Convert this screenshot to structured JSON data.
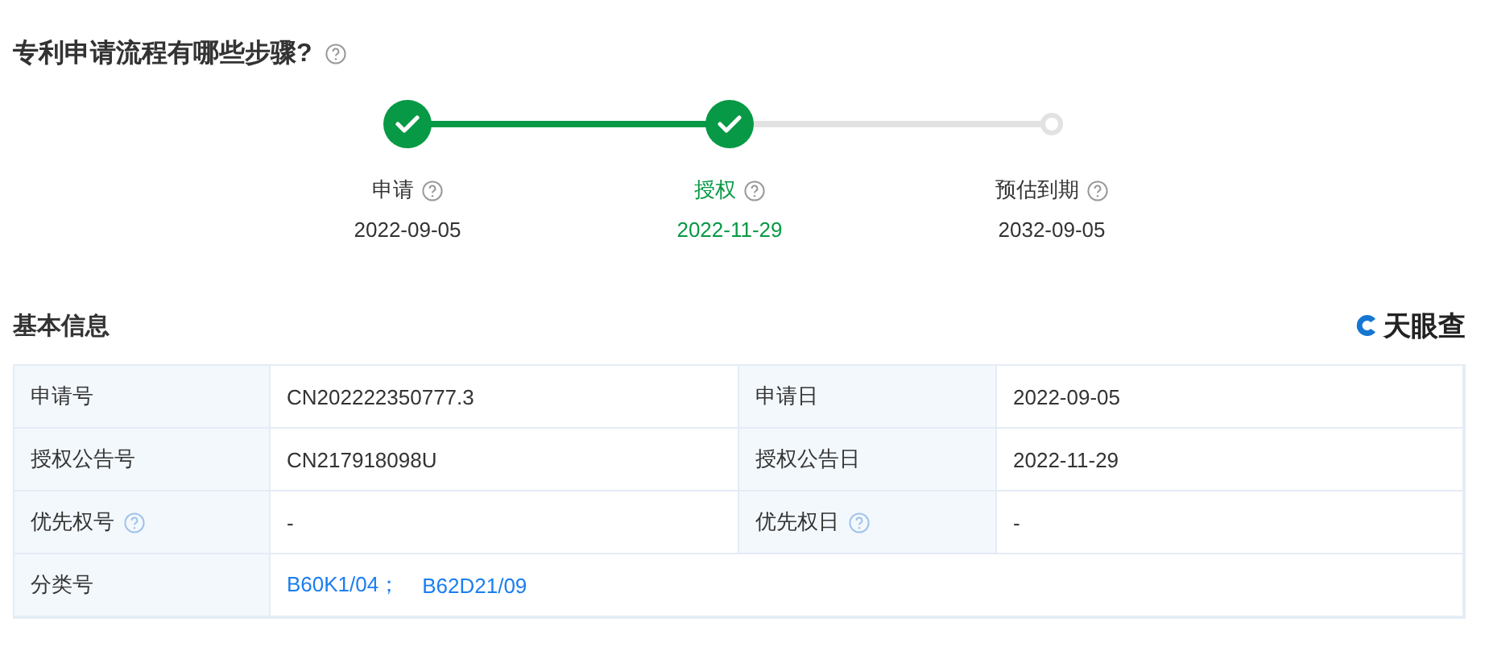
{
  "question": {
    "title": "专利申请流程有哪些步骤?"
  },
  "steps": [
    {
      "label": "申请",
      "date": "2022-09-05",
      "done": true,
      "current": false
    },
    {
      "label": "授权",
      "date": "2022-11-29",
      "done": true,
      "current": true
    },
    {
      "label": "预估到期",
      "date": "2032-09-05",
      "done": false,
      "current": false
    }
  ],
  "section": {
    "title": "基本信息",
    "brand": "天眼查"
  },
  "rows": [
    {
      "kind": "pair",
      "cells": [
        {
          "label": "申请号",
          "value": "CN202222350777.3",
          "help": false
        },
        {
          "label": "申请日",
          "value": "2022-09-05",
          "help": false
        }
      ]
    },
    {
      "kind": "pair",
      "cells": [
        {
          "label": "授权公告号",
          "value": "CN217918098U",
          "help": false
        },
        {
          "label": "授权公告日",
          "value": "2022-11-29",
          "help": false
        }
      ]
    },
    {
      "kind": "pair",
      "cells": [
        {
          "label": "优先权号",
          "value": "-",
          "help": true
        },
        {
          "label": "优先权日",
          "value": "-",
          "help": true
        }
      ]
    },
    {
      "kind": "links",
      "label": "分类号",
      "links": [
        "B60K1/04；",
        "B62D21/09"
      ]
    }
  ]
}
